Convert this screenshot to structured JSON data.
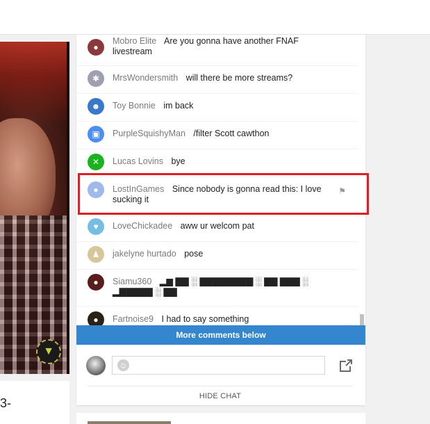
{
  "chat": {
    "messages": [
      {
        "author": "Mobro Elite",
        "text": "Are you gonna have another FNAF livestream",
        "avatar_icon": "user-icon",
        "avatar_color": "#8a3a3a"
      },
      {
        "author": "MrsWondersmith",
        "text": "will there be more streams?",
        "avatar_icon": "user-icon",
        "avatar_color": "#9f9fb2"
      },
      {
        "author": "Toy Bonnie",
        "text": "im back",
        "avatar_icon": "user-icon",
        "avatar_color": "#3a78c9"
      },
      {
        "author": "PurpleSquishyMan",
        "text": "/filter Scott cawthon",
        "avatar_icon": "user-icon",
        "avatar_color": "#4d8ef0"
      },
      {
        "author": "Lucas Lovins",
        "text": "bye",
        "avatar_icon": "user-icon",
        "avatar_color": "#19b31e"
      },
      {
        "author": "LostInGames",
        "text": "Since nobody is gonna read this: I love sucking it",
        "avatar_icon": "user-icon",
        "avatar_color": "#9fb9ea"
      },
      {
        "author": "LoveChickadee",
        "text": "aww ur welcom pat",
        "avatar_icon": "user-icon",
        "avatar_color": "#76bde3"
      },
      {
        "author": "jakelyne hurtado",
        "text": "pose",
        "avatar_icon": "user-icon",
        "avatar_color": "#d7c69a"
      },
      {
        "author": "Siamu360",
        "text": "▂▆ ▇▇ ░ ▇▇▇▇▇▇▇▇ ░ ▇▇ ▇▇▇ ░ ▂▇▇▇▇▇ ░ ▇▇",
        "avatar_icon": "user-icon",
        "avatar_color": "#5a1d1d"
      },
      {
        "author": "Fartnoise9",
        "text": "I had to say something",
        "avatar_icon": "user-icon",
        "avatar_color": "#2b2215"
      }
    ],
    "more_comments_label": "More comments below",
    "hide_chat_label": "HIDE CHAT",
    "input_placeholder": ""
  },
  "left_card": {
    "snippet": "3-"
  },
  "colors": {
    "highlight": "#e01e27",
    "more_bar": "#3487cf"
  }
}
